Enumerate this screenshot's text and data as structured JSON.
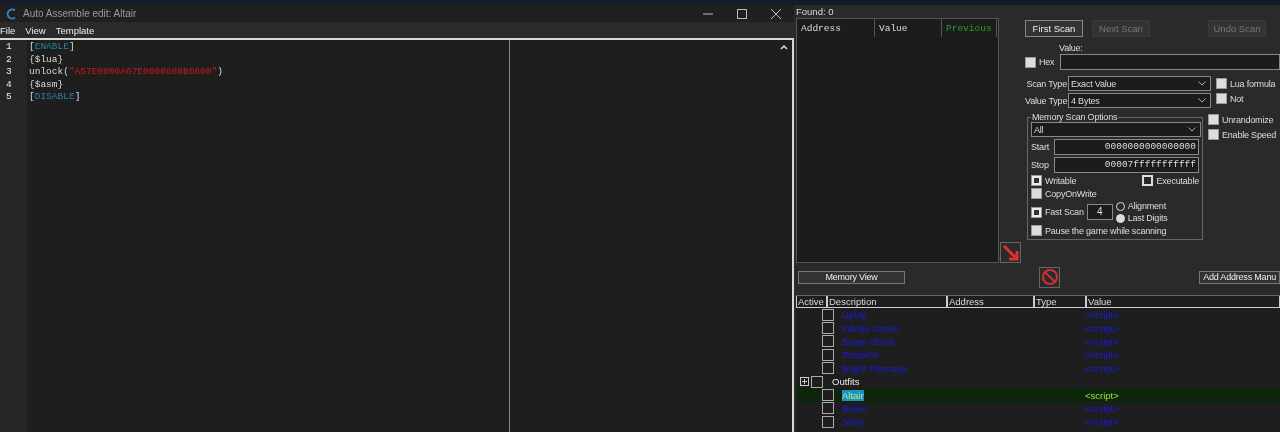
{
  "editor": {
    "title": "Auto Assemble edit: Altair",
    "menu": [
      "File",
      "View",
      "Template"
    ],
    "lines": [
      {
        "number": "1",
        "tokens": [
          {
            "kind": "punct",
            "text": "["
          },
          {
            "kind": "keyword",
            "text": "ENABLE"
          },
          {
            "kind": "punct",
            "text": "]"
          }
        ]
      },
      {
        "number": "2",
        "tokens": [
          {
            "kind": "plain",
            "text": "{$lua}"
          }
        ]
      },
      {
        "number": "3",
        "tokens": [
          {
            "kind": "plain",
            "text": "unlock("
          },
          {
            "kind": "string",
            "text": "\"A57E0800A67E0800888B0800\""
          },
          {
            "kind": "plain",
            "text": ")"
          }
        ]
      },
      {
        "number": "4",
        "tokens": [
          {
            "kind": "plain",
            "text": "{$asm}"
          }
        ]
      },
      {
        "number": "5",
        "tokens": [
          {
            "kind": "punct",
            "text": "["
          },
          {
            "kind": "keyword",
            "text": "DISABLE"
          },
          {
            "kind": "punct",
            "text": "]"
          }
        ]
      }
    ]
  },
  "scanner": {
    "found": "Found: 0",
    "result_columns": [
      "Address",
      "Value",
      "Previous"
    ],
    "buttons": [
      {
        "label": "First Scan",
        "disabled": false
      },
      {
        "label": "Next Scan",
        "disabled": true
      },
      {
        "label": "Undo Scan",
        "disabled": true
      }
    ],
    "value_label": "Value:",
    "hex": {
      "label": "Hex",
      "checked": false
    },
    "scan_type": {
      "label": "Scan Type",
      "value": "Exact Value"
    },
    "value_type": {
      "label": "Value Type",
      "value": "4 Bytes"
    },
    "side_options": [
      {
        "label": "Lua formula",
        "checked": false
      },
      {
        "label": "Not",
        "checked": false
      }
    ],
    "side_options_2": [
      {
        "label": "Unrandomize",
        "checked": false
      },
      {
        "label": "Enable Speed",
        "checked": false
      }
    ],
    "memory": {
      "title": "Memory Scan Options",
      "region": "All",
      "start_label": "Start",
      "start": "0000000000000000",
      "stop_label": "Stop",
      "stop": "00007fffffffffff",
      "writable": {
        "label": "Writable",
        "checked": true
      },
      "executable": {
        "label": "Executable",
        "checked": false
      },
      "copy_on_write": {
        "label": "CopyOnWrite",
        "checked": false
      },
      "fast_scan": {
        "label": "Fast Scan",
        "checked": true,
        "value": "4"
      },
      "fast_modes": [
        {
          "label": "Alignment",
          "selected": false
        },
        {
          "label": "Last Digits",
          "selected": true
        }
      ],
      "pause": {
        "label": "Pause the game while scanning",
        "checked": false
      }
    },
    "memory_view": "Memory View",
    "add_address": "Add Address Manu"
  },
  "table": {
    "columns": [
      "Active",
      "Description",
      "Address",
      "Type",
      "Value"
    ],
    "rows": [
      {
        "kind": "script",
        "description": "Uplay",
        "value": "<script>",
        "checked": false,
        "selected": false
      },
      {
        "kind": "script",
        "description": "Infinite Green",
        "value": "<script>",
        "checked": false,
        "selected": false
      },
      {
        "kind": "script",
        "description": "Beige Ghost",
        "value": "<script>",
        "checked": false,
        "selected": false
      },
      {
        "kind": "script",
        "description": "Tempest",
        "value": "<script>",
        "checked": false,
        "selected": false
      },
      {
        "kind": "script",
        "description": "Bright Plumage",
        "value": "<script>",
        "checked": false,
        "selected": false
      },
      {
        "kind": "group",
        "description": "Outfits",
        "checked": false,
        "expanded": false,
        "selected": false
      },
      {
        "kind": "script",
        "description": "Altair",
        "value": "<script>",
        "checked": false,
        "selected": true
      },
      {
        "kind": "script",
        "description": "Bellec",
        "value": "<script>",
        "checked": false,
        "selected": false
      },
      {
        "kind": "script",
        "description": "Shay",
        "value": "<script>",
        "checked": false,
        "selected": false
      }
    ]
  }
}
